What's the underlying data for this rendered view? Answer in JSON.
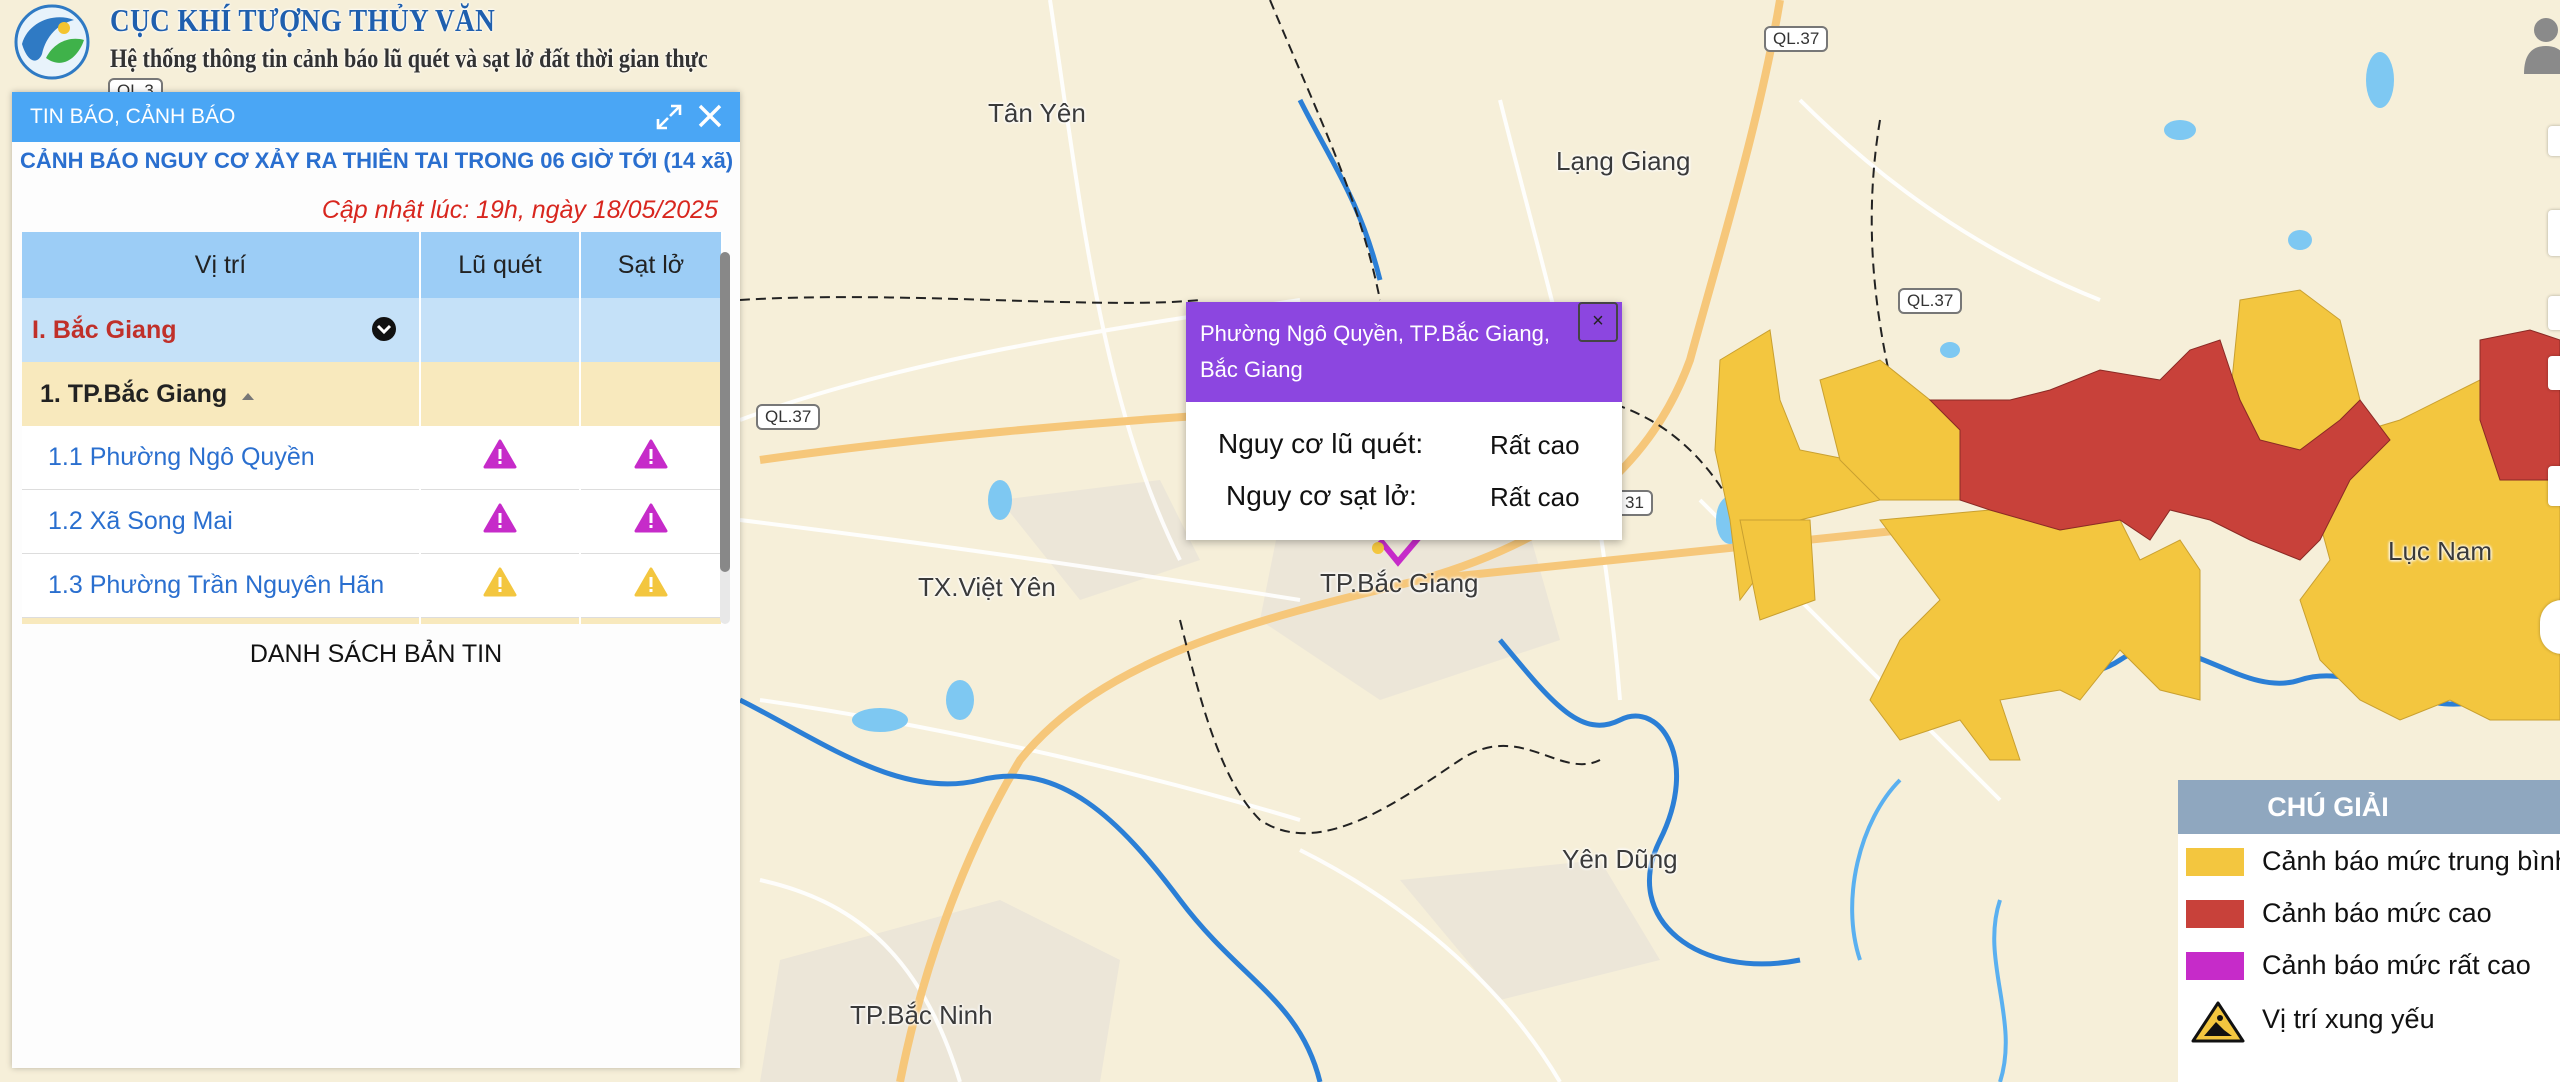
{
  "header": {
    "agency": "CỤC KHÍ TƯỢNG THỦY VĂN",
    "subtitle": "Hệ thống thông tin cảnh báo lũ quét và sạt lở đất thời gian thực"
  },
  "panel": {
    "title": "TIN BÁO, CẢNH BÁO",
    "warning_title": "CẢNH BÁO NGUY CƠ XẢY RA THIÊN TAI TRONG 06 GIỜ TỚI (14 xã)",
    "updated": "Cập nhật lúc: 19h, ngày 18/05/2025",
    "columns": [
      "Vị trí",
      "Lũ quét",
      "Sạt lở"
    ],
    "province": "I. Bắc Giang",
    "district": "1. TP.Bắc Giang",
    "rows": [
      {
        "name": "1.1  Phường Ngô Quyền",
        "flash_flood": "rất cao",
        "landslide": "rất cao"
      },
      {
        "name": "1.2  Xã Song Mai",
        "flash_flood": "rất cao",
        "landslide": "rất cao"
      },
      {
        "name": "1.3  Phường Trần Nguyên Hãn",
        "flash_flood": "trung bình",
        "landslide": "trung bình"
      }
    ],
    "bulletin_heading": "DANH SÁCH BẢN TIN"
  },
  "popup": {
    "title": "Phường Ngô Quyền, TP.Bắc Giang, Bắc Giang",
    "close": "×",
    "flood_label": "Nguy cơ lũ quét:",
    "flood_value": "Rất cao",
    "landslide_label": "Nguy cơ sạt lở:",
    "landslide_value": "Rất cao"
  },
  "map_labels": {
    "tan_yen": "Tân Yên",
    "lang_giang": "Lạng Giang",
    "viet_yen": "TX.Việt Yên",
    "bac_giang": "TP.Bắc Giang",
    "luc_nam": "Lục Nam",
    "yen_dung": "Yên Dũng",
    "bac_ninh": "TP.Bắc Ninh"
  },
  "road_shields": {
    "ql37_top": "QL.37",
    "ql37_right": "QL.37",
    "ql37_left": "QL.37",
    "ql31": "31",
    "ql3": "QL.3"
  },
  "legend": {
    "title": "CHÚ GIẢI",
    "items": [
      {
        "label": "Cảnh báo mức trung bình",
        "color": "#f3c63f"
      },
      {
        "label": "Cảnh báo mức cao",
        "color": "#c8413a"
      },
      {
        "label": "Cảnh báo mức rất cao",
        "color": "#c62bc9"
      },
      {
        "label": "Vị trí xung yếu",
        "icon": "landslide-warning-icon"
      }
    ]
  },
  "colors": {
    "panel_bar": "#4aa6f5",
    "popup_header": "#8c46e0",
    "level_medium": "#f3c63f",
    "level_high": "#c8413a",
    "level_very_high": "#c62bc9"
  }
}
